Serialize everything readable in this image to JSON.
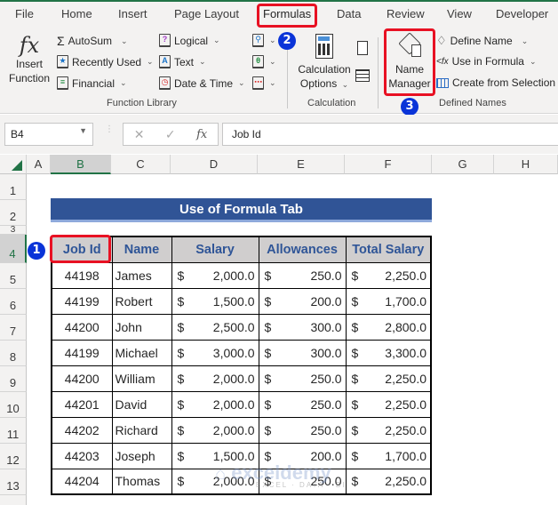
{
  "ribbon": {
    "tabs": [
      {
        "label": "File",
        "active": false
      },
      {
        "label": "Home",
        "active": false
      },
      {
        "label": "Insert",
        "active": false
      },
      {
        "label": "Page Layout",
        "active": false
      },
      {
        "label": "Formulas",
        "active": true
      },
      {
        "label": "Data",
        "active": false
      },
      {
        "label": "Review",
        "active": false
      },
      {
        "label": "View",
        "active": false
      },
      {
        "label": "Developer",
        "active": false
      }
    ],
    "function_library": {
      "group_label": "Function Library",
      "insert_function": {
        "line1": "Insert",
        "line2": "Function"
      },
      "autosum": "AutoSum",
      "recently_used": "Recently Used",
      "financial": "Financial",
      "logical": "Logical",
      "text": "Text",
      "date_time": "Date & Time"
    },
    "calculation": {
      "group_label": "Calculation",
      "options_line1": "Calculation",
      "options_line2": "Options"
    },
    "defined_names": {
      "group_label": "Defined Names",
      "name_manager_line1": "Name",
      "name_manager_line2": "Manager",
      "define_name": "Define Name",
      "use_in_formula": "Use in Formula",
      "create_from_selection": "Create from Selection"
    },
    "annotations": [
      "1",
      "2",
      "3"
    ]
  },
  "formula_bar": {
    "name_box": "B4",
    "formula": "Job Id",
    "fx_label": "fx"
  },
  "grid": {
    "columns": [
      "A",
      "B",
      "C",
      "D",
      "E",
      "F",
      "G",
      "H"
    ],
    "selected_column": "B",
    "rows": [
      "1",
      "2",
      "3",
      "4",
      "5",
      "6",
      "7",
      "8",
      "9",
      "10",
      "11",
      "12",
      "13"
    ],
    "selected_row": "4"
  },
  "sheet": {
    "title": "Use of Formula Tab",
    "headers": [
      "Job Id",
      "Name",
      "Salary",
      "Allowances",
      "Total Salary"
    ],
    "currency_symbol": "$",
    "rows": [
      {
        "id": "44198",
        "name": "James",
        "salary": "2,000.0",
        "allowance": "250.0",
        "total": "2,250.0"
      },
      {
        "id": "44199",
        "name": "Robert",
        "salary": "1,500.0",
        "allowance": "200.0",
        "total": "1,700.0"
      },
      {
        "id": "44200",
        "name": "John",
        "salary": "2,500.0",
        "allowance": "300.0",
        "total": "2,800.0"
      },
      {
        "id": "44199",
        "name": "Michael",
        "salary": "3,000.0",
        "allowance": "300.0",
        "total": "3,300.0"
      },
      {
        "id": "44200",
        "name": "William",
        "salary": "2,000.0",
        "allowance": "250.0",
        "total": "2,250.0"
      },
      {
        "id": "44201",
        "name": "David",
        "salary": "2,000.0",
        "allowance": "250.0",
        "total": "2,250.0"
      },
      {
        "id": "44202",
        "name": "Richard",
        "salary": "2,000.0",
        "allowance": "250.0",
        "total": "2,250.0"
      },
      {
        "id": "44203",
        "name": "Joseph",
        "salary": "1,500.0",
        "allowance": "200.0",
        "total": "1,700.0"
      },
      {
        "id": "44204",
        "name": "Thomas",
        "salary": "2,000.0",
        "allowance": "250.0",
        "total": "2,250.0"
      }
    ]
  },
  "watermark": {
    "brand": "exceldemy",
    "tagline": "EXCEL · DATA · BI"
  },
  "colors": {
    "excel_green": "#217346",
    "title_fill": "#305496",
    "header_fill": "#d0cece",
    "header_text": "#2f5597",
    "highlight_red": "#e81123",
    "badge_blue": "#0a34d8"
  }
}
